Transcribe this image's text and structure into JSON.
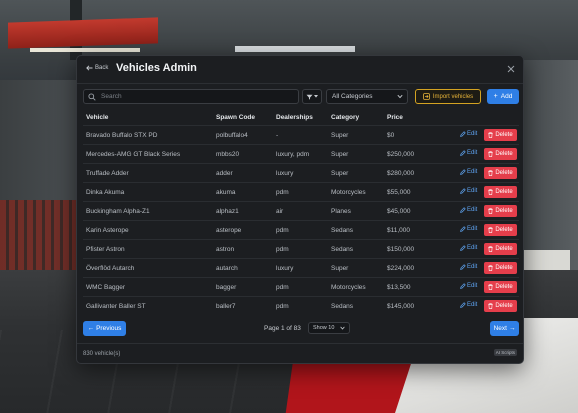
{
  "header": {
    "back_label": "Back",
    "title": "Vehicles Admin"
  },
  "toolbar": {
    "search_placeholder": "Search",
    "category_selected": "All Categories",
    "import_label": "Import vehicles",
    "add_label": "Add"
  },
  "table": {
    "columns": [
      "Vehicle",
      "Spawn Code",
      "Dealerships",
      "Category",
      "Price"
    ],
    "rows": [
      {
        "vehicle": "Bravado Buffalo STX PD",
        "spawn": "polbuffalo4",
        "dealerships": "-",
        "category": "Super",
        "price": "$0"
      },
      {
        "vehicle": "Mercedes-AMG GT Black Series",
        "spawn": "mbbs20",
        "dealerships": "luxury, pdm",
        "category": "Super",
        "price": "$250,000"
      },
      {
        "vehicle": "Truffade Adder",
        "spawn": "adder",
        "dealerships": "luxury",
        "category": "Super",
        "price": "$280,000"
      },
      {
        "vehicle": "Dinka Akuma",
        "spawn": "akuma",
        "dealerships": "pdm",
        "category": "Motorcycles",
        "price": "$55,000"
      },
      {
        "vehicle": "Buckingham Alpha-Z1",
        "spawn": "alphaz1",
        "dealerships": "air",
        "category": "Planes",
        "price": "$45,000"
      },
      {
        "vehicle": "Karin Asterope",
        "spawn": "asterope",
        "dealerships": "pdm",
        "category": "Sedans",
        "price": "$11,000"
      },
      {
        "vehicle": "Pfister Astron",
        "spawn": "astron",
        "dealerships": "pdm",
        "category": "Sedans",
        "price": "$150,000"
      },
      {
        "vehicle": "Överflöd Autarch",
        "spawn": "autarch",
        "dealerships": "luxury",
        "category": "Super",
        "price": "$224,000"
      },
      {
        "vehicle": "WMC Bagger",
        "spawn": "bagger",
        "dealerships": "pdm",
        "category": "Motorcycles",
        "price": "$13,500"
      },
      {
        "vehicle": "Gallivanter Baller ST",
        "spawn": "baller7",
        "dealerships": "pdm",
        "category": "Sedans",
        "price": "$145,000"
      }
    ],
    "edit_label": "Edit",
    "delete_label": "Delete"
  },
  "pager": {
    "prev_label": "Previous",
    "page_info": "Page 1 of 83",
    "show_selected": "Show 10",
    "next_label": "Next"
  },
  "footer": {
    "count": "830 vehicle(s)",
    "badge": "AI Scripts"
  },
  "colors": {
    "accent": "#2f7fe6",
    "danger": "#e53e4b",
    "import": "#d4a322",
    "modal_bg": "#1c1e21"
  }
}
